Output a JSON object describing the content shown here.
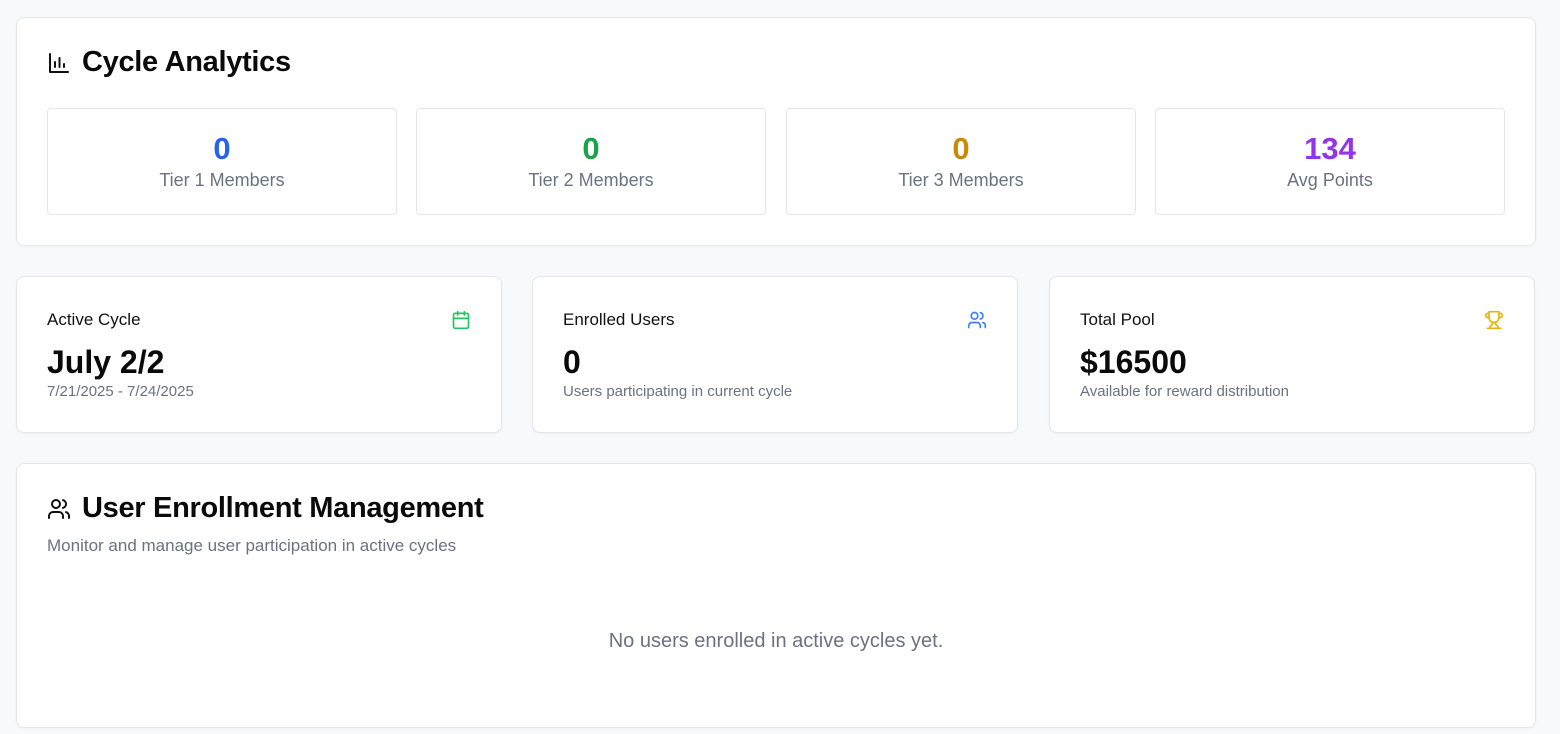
{
  "analytics": {
    "title": "Cycle Analytics",
    "icon": "bar-chart-icon",
    "tiers": [
      {
        "value": "0",
        "label": "Tier 1 Members",
        "color": "#2563eb"
      },
      {
        "value": "0",
        "label": "Tier 2 Members",
        "color": "#16a34a"
      },
      {
        "value": "0",
        "label": "Tier 3 Members",
        "color": "#ca8a04"
      },
      {
        "value": "134",
        "label": "Avg Points",
        "color": "#9333ea"
      }
    ]
  },
  "stats": [
    {
      "label": "Active Cycle",
      "value": "July 2/2",
      "sub": "7/21/2025 - 7/24/2025",
      "icon": "calendar-icon",
      "icon_color": "#22c55e"
    },
    {
      "label": "Enrolled Users",
      "value": "0",
      "sub": "Users participating in current cycle",
      "icon": "users-icon",
      "icon_color": "#3b82f6"
    },
    {
      "label": "Total Pool",
      "value": "$16500",
      "sub": "Available for reward distribution",
      "icon": "trophy-icon",
      "icon_color": "#eab308"
    }
  ],
  "enrollment": {
    "title": "User Enrollment Management",
    "icon": "users-icon",
    "description": "Monitor and manage user participation in active cycles",
    "empty_message": "No users enrolled in active cycles yet."
  }
}
